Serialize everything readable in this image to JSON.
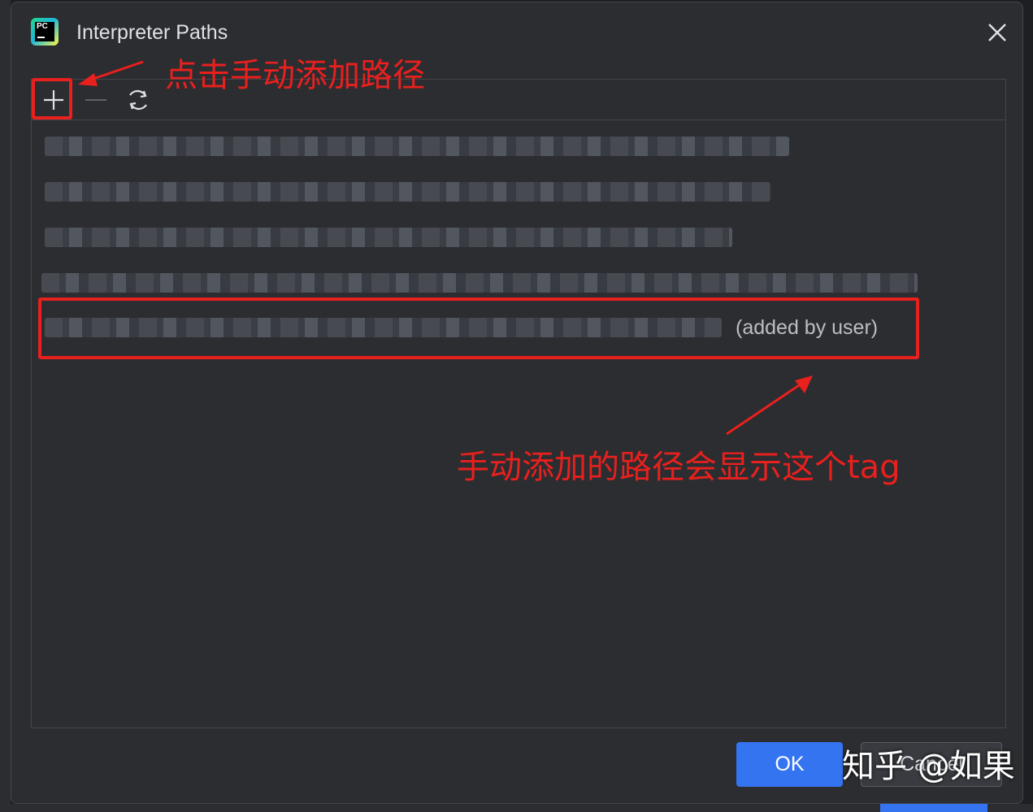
{
  "window": {
    "title": "Interpreter Paths",
    "app_icon_text": "PC"
  },
  "toolbar": {
    "add": "plus-icon",
    "remove": "minus-icon",
    "reload": "refresh-icon"
  },
  "paths": [
    {
      "text": "",
      "tag": ""
    },
    {
      "text": "",
      "tag": ""
    },
    {
      "text": "",
      "tag": ""
    },
    {
      "text": "",
      "tag": ""
    },
    {
      "text": "",
      "tag": "(added by user)"
    }
  ],
  "annotations": {
    "add_hint": "点击手动添加路径",
    "tag_hint": "手动添加的路径会显示这个tag"
  },
  "buttons": {
    "ok": "OK",
    "cancel": "Cancel"
  },
  "watermark": "知乎 @如果",
  "colors": {
    "accent": "#3574f0",
    "annotation": "#e8201e",
    "background": "#2b2d30"
  }
}
